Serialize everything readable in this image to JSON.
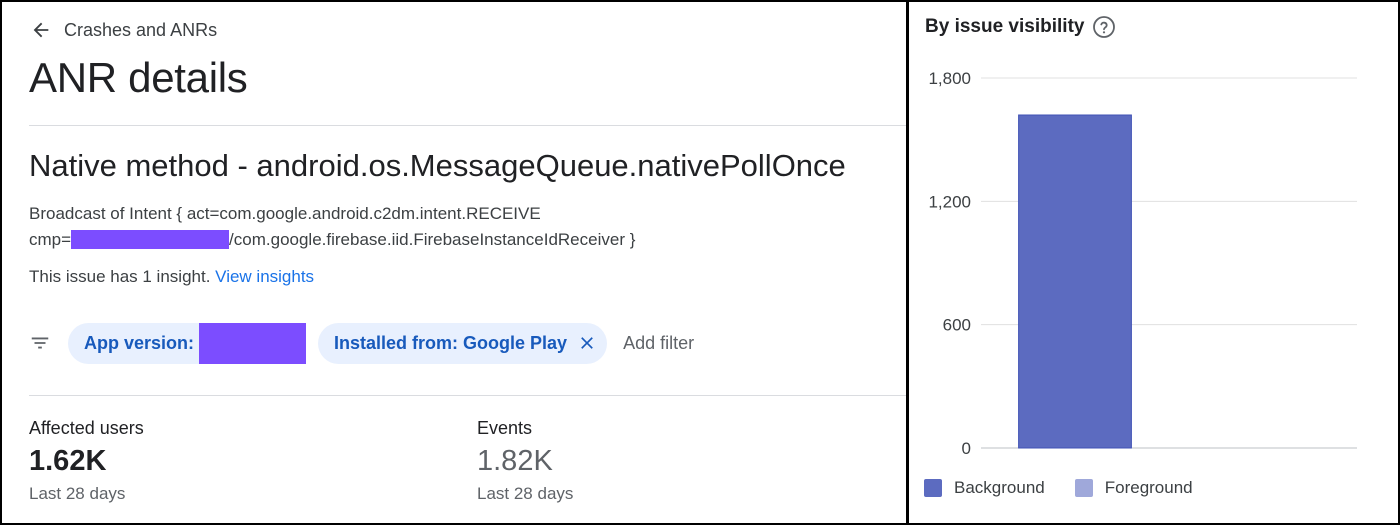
{
  "nav": {
    "back_label": "Crashes and ANRs"
  },
  "page": {
    "title": "ANR details"
  },
  "issue": {
    "title": "Native method - android.os.MessageQueue.nativePollOnce",
    "intent_line1": "Broadcast of Intent { act=com.google.android.c2dm.intent.RECEIVE",
    "intent_line2_prefix": "cmp=",
    "intent_line2_suffix": "/com.google.firebase.iid.FirebaseInstanceIdReceiver }",
    "insight_text": "This issue has 1 insight.",
    "insight_link": "View insights"
  },
  "filters": {
    "app_version_label": "App version:",
    "installed_from_label": "Installed from: Google Play",
    "add_filter_label": "Add filter"
  },
  "stats": {
    "affected_users": {
      "label": "Affected users",
      "value": "1.62K",
      "sub": "Last 28 days"
    },
    "events": {
      "label": "Events",
      "value": "1.82K",
      "sub": "Last 28 days"
    }
  },
  "colors": {
    "redaction": "#7c4dff",
    "background_series": "#5c6bc0",
    "foreground_series": "#9fa8da",
    "link": "#1a73e8",
    "chip_bg": "#e8f0fe",
    "chip_text": "#185abc"
  },
  "icons": [
    "arrow-back-icon",
    "filter-list-icon",
    "close-icon",
    "help-icon"
  ],
  "chart_data": {
    "type": "bar",
    "title": "By issue visibility",
    "categories": [
      "Background",
      "Foreground"
    ],
    "series": [
      {
        "name": "Background",
        "values": [
          1620,
          0
        ],
        "color": "#5c6bc0"
      },
      {
        "name": "Foreground",
        "values": [
          0,
          0
        ],
        "color": "#9fa8da"
      }
    ],
    "ylim": [
      0,
      1800
    ],
    "yticks": [
      0,
      600,
      1200,
      1800
    ],
    "ytick_labels": [
      "0",
      "600",
      "1,200",
      "1,800"
    ],
    "grid": true,
    "legend": "bottom-left"
  }
}
